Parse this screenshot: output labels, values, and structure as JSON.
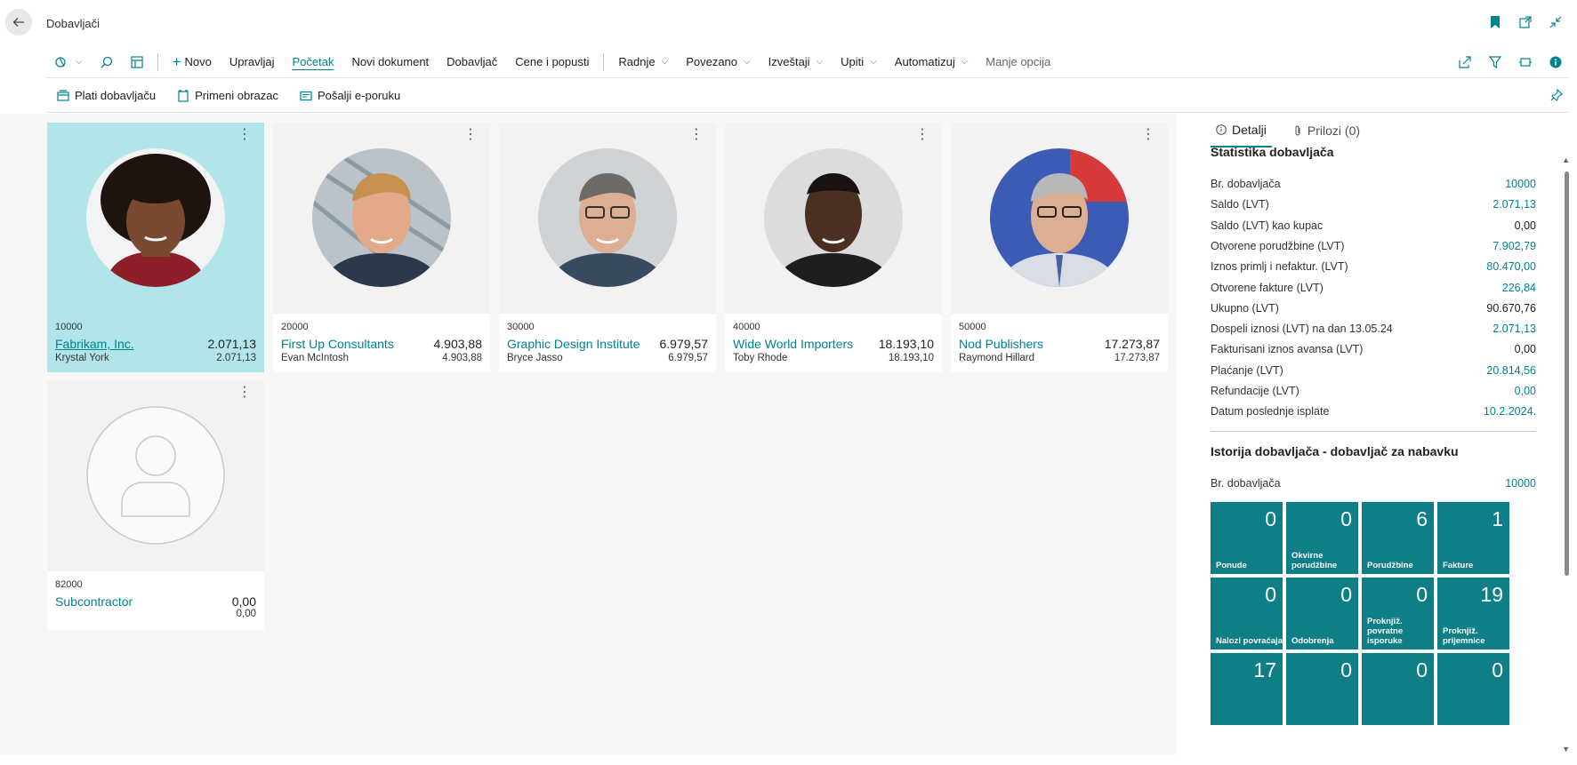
{
  "header": {
    "title": "Dobavljači"
  },
  "actions": {
    "novo": "Novo",
    "upravljaj": "Upravljaj",
    "pocetak": "Početak",
    "novi_dokument": "Novi dokument",
    "dobavljac": "Dobavljač",
    "cene": "Cene i popusti",
    "radnje": "Radnje",
    "povezano": "Povezano",
    "izvestaji": "Izveštaji",
    "upiti": "Upiti",
    "automatizuj": "Automatizuj",
    "manje_opcija": "Manje opcija"
  },
  "promoted": {
    "plati": "Plati dobavljaču",
    "primeni": "Primeni obrazac",
    "posalji": "Pošalji e-poruku"
  },
  "cards": [
    {
      "no": "10000",
      "name": "Fabrikam, Inc.",
      "balance": "2.071,13",
      "contact": "Krystal York",
      "balance2": "2.071,13"
    },
    {
      "no": "20000",
      "name": "First Up Consultants",
      "balance": "4.903,88",
      "contact": "Evan McIntosh",
      "balance2": "4.903,88"
    },
    {
      "no": "30000",
      "name": "Graphic Design Institute",
      "balance": "6.979,57",
      "contact": "Bryce Jasso",
      "balance2": "6.979,57"
    },
    {
      "no": "40000",
      "name": "Wide World Importers",
      "balance": "18.193,10",
      "contact": "Toby Rhode",
      "balance2": "18.193,10"
    },
    {
      "no": "50000",
      "name": "Nod Publishers",
      "balance": "17.273,87",
      "contact": "Raymond Hillard",
      "balance2": "17.273,87"
    },
    {
      "no": "82000",
      "name": "Subcontractor",
      "balance": "0,00",
      "contact": "",
      "balance2": "0,00"
    }
  ],
  "factbox": {
    "tab_details": "Detalji",
    "tab_attachments": "Prilozi (0)",
    "stats_title": "Statistika dobavljača",
    "stats": [
      {
        "label": "Br. dobavljača",
        "value": "10000"
      },
      {
        "label": "Saldo (LVT)",
        "value": "2.071,13"
      },
      {
        "label": "Saldo (LVT) kao kupac",
        "value": "0,00"
      },
      {
        "label": "Otvorene porudžbine (LVT)",
        "value": "7.902,79"
      },
      {
        "label": "Iznos primlj i nefaktur. (LVT)",
        "value": "80.470,00"
      },
      {
        "label": "Otvorene fakture (LVT)",
        "value": "226,84"
      },
      {
        "label": "Ukupno (LVT)",
        "value": "90.670,76"
      },
      {
        "label": "Dospeli iznosi (LVT) na dan 13.05.24",
        "value": "2.071,13"
      },
      {
        "label": "Fakturisani iznos avansa (LVT)",
        "value": "0,00"
      },
      {
        "label": "Plaćanje (LVT)",
        "value": "20.814,56"
      },
      {
        "label": "Refundacije (LVT)",
        "value": "0,00"
      },
      {
        "label": "Datum poslednje isplate",
        "value": "10.2.2024."
      }
    ],
    "history_title": "Istorija dobavljača - dobavljač za nabavku",
    "history_no_label": "Br. dobavljača",
    "history_no_value": "10000",
    "tiles": [
      {
        "num": "0",
        "label": "Ponude"
      },
      {
        "num": "0",
        "label": "Okvirne porudžbine"
      },
      {
        "num": "6",
        "label": "Porudžbine"
      },
      {
        "num": "1",
        "label": "Fakture"
      },
      {
        "num": "0",
        "label": "Nalozi povraćaja"
      },
      {
        "num": "0",
        "label": "Odobrenja"
      },
      {
        "num": "0",
        "label": "Proknjiž. povratne isporuke"
      },
      {
        "num": "19",
        "label": "Proknjiž. prijemnice"
      },
      {
        "num": "17",
        "label": ""
      },
      {
        "num": "0",
        "label": ""
      },
      {
        "num": "0",
        "label": ""
      },
      {
        "num": "0",
        "label": ""
      }
    ]
  },
  "colors": {
    "accent": "#00838f",
    "tile": "#0e7f87",
    "selected": "#b2e5ea"
  }
}
